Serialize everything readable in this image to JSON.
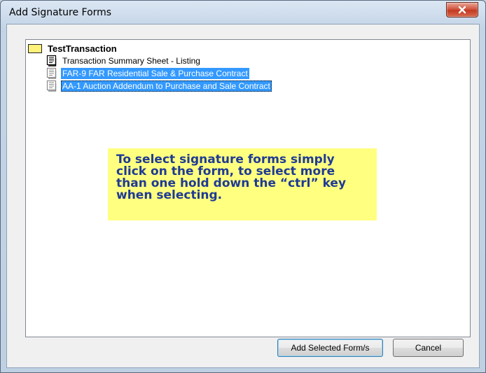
{
  "window": {
    "title": "Add Signature Forms"
  },
  "tree": {
    "root_label": "TestTransaction",
    "items": [
      {
        "label": "Transaction Summary Sheet - Listing",
        "selected": false
      },
      {
        "label": "FAR-9  FAR Residential Sale & Purchase Contract",
        "selected": true
      },
      {
        "label": "AA-1  Auction Addendum to Purchase and Sale Contract",
        "selected": true
      }
    ]
  },
  "callout": {
    "text": "To select signature forms simply click on the form, to select more than one hold down the “ctrl” key when selecting."
  },
  "buttons": {
    "add_label": "Add Selected Form/s",
    "cancel_label": "Cancel"
  },
  "colors": {
    "selection": "#3399ff",
    "callout_bg": "#ffff80",
    "callout_text": "#1f3a93"
  },
  "icons": {
    "close": "close-icon",
    "folder": "folder-icon",
    "document": "document-icon"
  }
}
